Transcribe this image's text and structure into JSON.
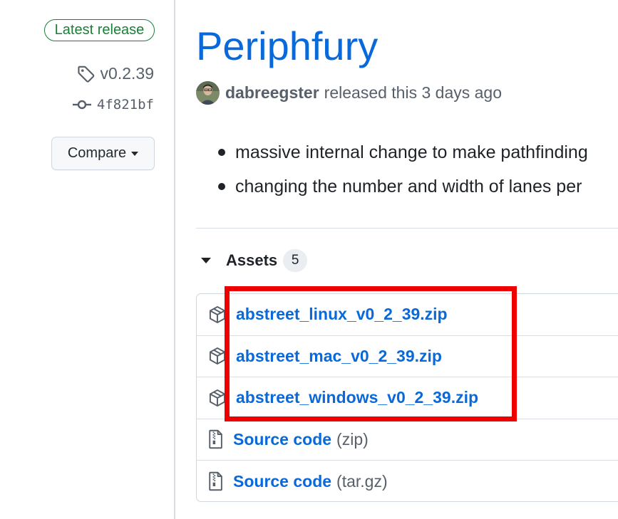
{
  "sidebar": {
    "latest_badge": "Latest release",
    "tag": "v0.2.39",
    "commit": "4f821bf",
    "compare_label": "Compare"
  },
  "release": {
    "title": "Periphfury",
    "author": "dabreegster",
    "released_text": "released this 3 days ago",
    "notes": [
      "massive internal change to make pathfinding",
      "changing the number and width of lanes per"
    ]
  },
  "assets": {
    "heading": "Assets",
    "count": "5",
    "items": [
      {
        "name": "abstreet_linux_v0_2_39.zip",
        "suffix": "",
        "icon": "package-icon"
      },
      {
        "name": "abstreet_mac_v0_2_39.zip",
        "suffix": "",
        "icon": "package-icon"
      },
      {
        "name": "abstreet_windows_v0_2_39.zip",
        "suffix": "",
        "icon": "package-icon"
      },
      {
        "name": "Source code",
        "suffix": "(zip)",
        "icon": "file-zip-icon"
      },
      {
        "name": "Source code",
        "suffix": "(tar.gz)",
        "icon": "file-zip-icon"
      }
    ]
  },
  "colors": {
    "link": "#0969da",
    "badge_green": "#1a7f37",
    "highlight_red": "#ee0000",
    "muted": "#57606a"
  }
}
